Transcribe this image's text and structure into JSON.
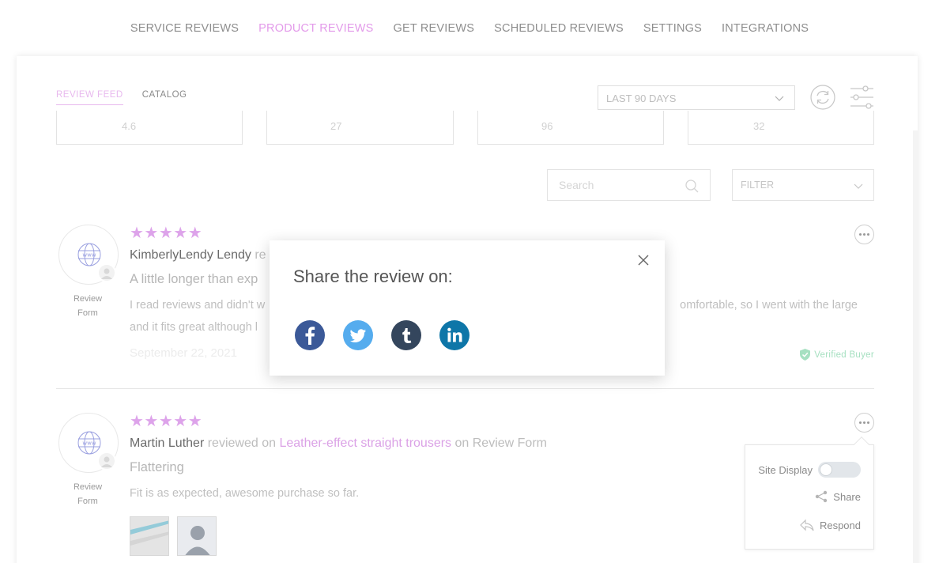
{
  "nav": {
    "items": [
      {
        "label": "SERVICE REVIEWS",
        "active": false
      },
      {
        "label": "PRODUCT REVIEWS",
        "active": true
      },
      {
        "label": "GET REVIEWS",
        "active": false
      },
      {
        "label": "SCHEDULED REVIEWS",
        "active": false
      },
      {
        "label": "SETTINGS",
        "active": false
      },
      {
        "label": "INTEGRATIONS",
        "active": false
      }
    ]
  },
  "sub_tabs": {
    "feed": "REVIEW FEED",
    "catalog": "CATALOG"
  },
  "period": {
    "value": "LAST 90 DAYS"
  },
  "stats": {
    "values": [
      "4.6",
      "27",
      "96",
      "32"
    ]
  },
  "search": {
    "placeholder": "Search"
  },
  "filter": {
    "label": "FILTER"
  },
  "reviews": [
    {
      "stars": "★★★★★",
      "reviewer": "KimberlyLendy Lendy",
      "verb_fragment": "re",
      "title_fragment": "A little longer than exp",
      "body_left_1": "I read reviews and didn't w",
      "body_right_1": "omfortable, so I went with the large",
      "body_left_2": "and it fits great although l",
      "date": "September 22, 2021",
      "verified": "Verified Buyer",
      "source_line1": "Review",
      "source_line2": "Form"
    },
    {
      "stars": "★★★★★",
      "reviewer": "Martin Luther",
      "reviewed_on": "reviewed on",
      "product": "Leather-effect straight trousers",
      "on_text": "on Review Form",
      "title": "Flattering",
      "body": "Fit is as expected, awesome purchase so far.",
      "source_line1": "Review",
      "source_line2": "Form"
    }
  ],
  "action_menu": {
    "site_display": "Site Display",
    "site_display_on": false,
    "share": "Share",
    "respond": "Respond"
  },
  "modal": {
    "title": "Share the review on:",
    "networks": [
      "facebook-icon",
      "twitter-icon",
      "tumblr-icon",
      "linkedin-icon"
    ]
  },
  "colors": {
    "accent": "#e39bea",
    "stars": "#dda3ea",
    "facebook": "#3b5998",
    "twitter": "#55acee",
    "tumblr": "#34465d",
    "linkedin": "#0e76a8",
    "verified": "#a6e0c1"
  }
}
